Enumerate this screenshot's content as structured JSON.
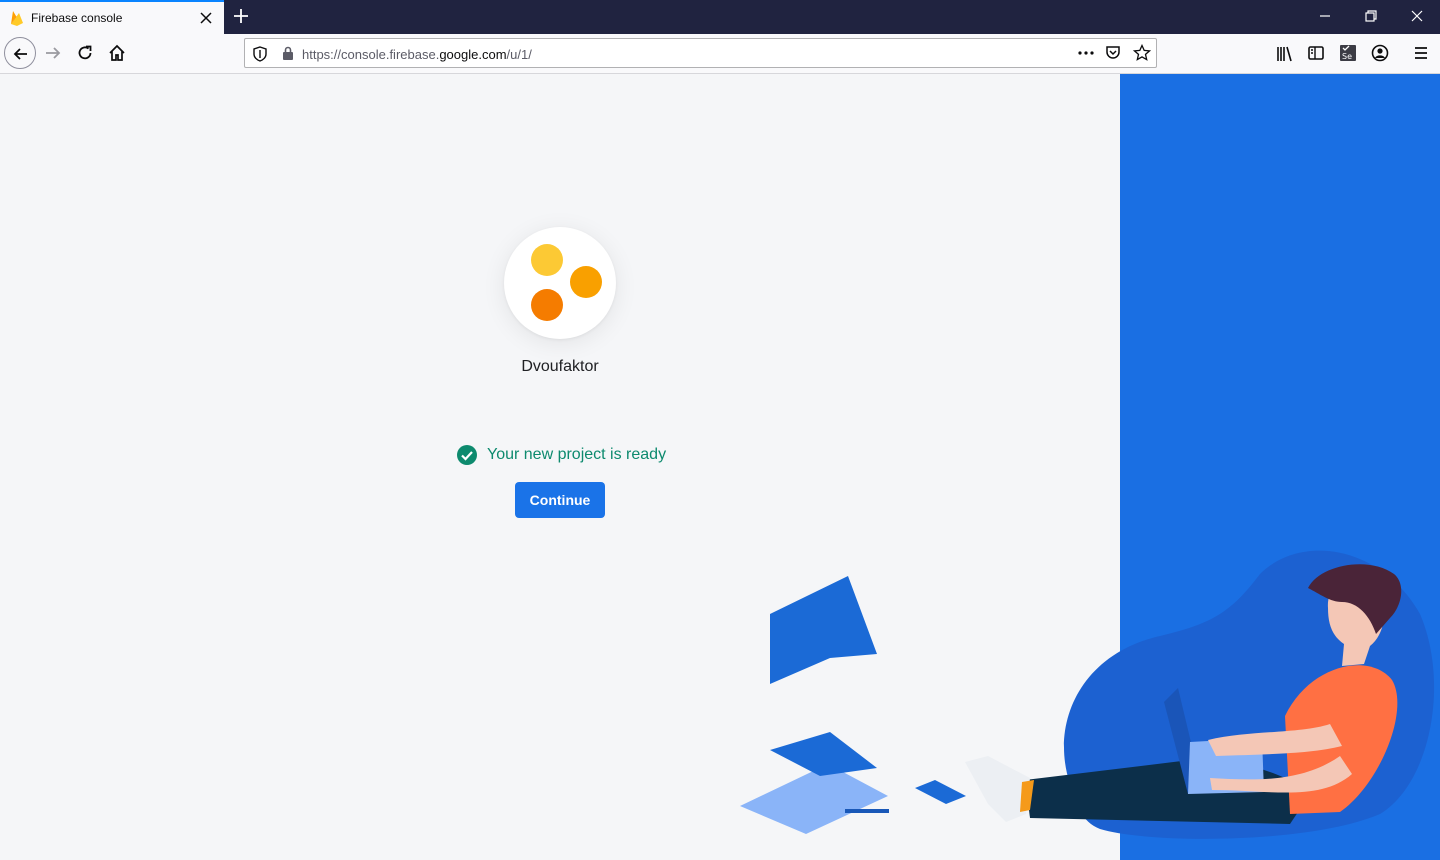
{
  "browser": {
    "tab_title": "Firebase console",
    "url_prefix": "https://console.firebase.",
    "url_host": "google.com",
    "url_path": "/u/1/"
  },
  "project": {
    "name": "Dvoufaktor",
    "avatar_colors": [
      "#fcc934",
      "#f9a000",
      "#f57c00"
    ]
  },
  "status": {
    "message": "Your new project is ready",
    "color": "#0d8a6e"
  },
  "actions": {
    "continue_label": "Continue"
  },
  "theme": {
    "accent": "#1a73e8",
    "panel_blue": "#1a6fe3",
    "background": "#f5f6f8"
  }
}
